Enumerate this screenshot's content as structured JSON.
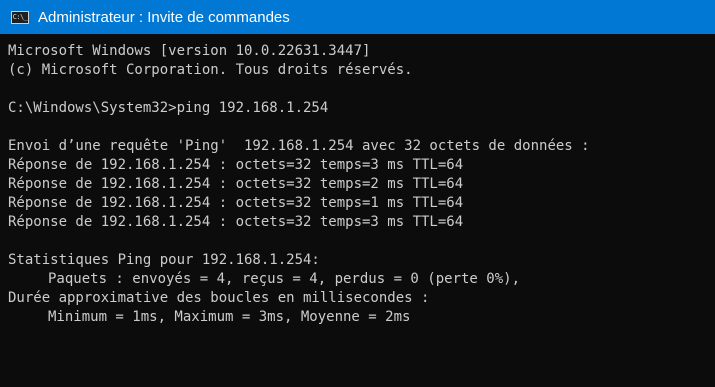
{
  "titlebar": {
    "icon": "cmd-icon",
    "icon_text": "C:\\_",
    "title": "Administrateur : Invite de commandes"
  },
  "console": {
    "lines": [
      "Microsoft Windows [version 10.0.22631.3447]",
      "(c) Microsoft Corporation. Tous droits réservés.",
      "",
      "C:\\Windows\\System32>ping 192.168.1.254",
      "",
      "Envoi d’une requête 'Ping'  192.168.1.254 avec 32 octets de données :",
      "Réponse de 192.168.1.254 : octets=32 temps=3 ms TTL=64",
      "Réponse de 192.168.1.254 : octets=32 temps=2 ms TTL=64",
      "Réponse de 192.168.1.254 : octets=32 temps=1 ms TTL=64",
      "Réponse de 192.168.1.254 : octets=32 temps=3 ms TTL=64",
      "",
      "Statistiques Ping pour 192.168.1.254:",
      "Paquets : envoyés = 4, reçus = 4, perdus = 0 (perte 0%),",
      "Durée approximative des boucles en millisecondes :",
      "Minimum = 1ms, Maximum = 3ms, Moyenne = 2ms"
    ]
  },
  "colors": {
    "titlebar_bg": "#0078d4",
    "console_bg": "#0c0c0c",
    "console_text": "#cccccc"
  }
}
